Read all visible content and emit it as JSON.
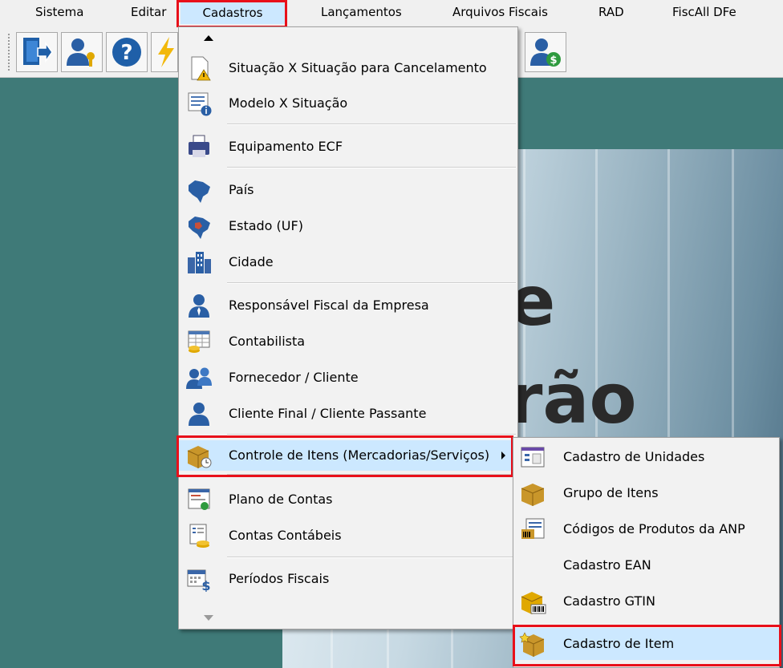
{
  "menubar": {
    "items": [
      "Sistema",
      "Editar",
      "Cadastros",
      "Lançamentos",
      "Arquivos Fiscais",
      "RAD",
      "FiscAll DFe"
    ],
    "active": "Cadastros"
  },
  "toolbar": {
    "buttons": [
      "exit-icon",
      "user-key-icon",
      "help-icon",
      "lightning-icon",
      "user-money-icon"
    ]
  },
  "banner": {
    "text_line1": "e",
    "text_line2": "rão"
  },
  "menu": {
    "items": [
      {
        "label": "Situação X Situação para Cancelamento",
        "icon": "document-warning-icon"
      },
      {
        "label": "Modelo X Situação",
        "icon": "form-info-icon"
      },
      {
        "label": "Equipamento ECF",
        "icon": "printer-icon"
      },
      {
        "label": "País",
        "icon": "brazil-map-icon"
      },
      {
        "label": "Estado (UF)",
        "icon": "brazil-state-map-icon"
      },
      {
        "label": "Cidade",
        "icon": "buildings-icon"
      },
      {
        "label": "Responsável Fiscal da Empresa",
        "icon": "person-tie-icon"
      },
      {
        "label": "Contabilista",
        "icon": "calculator-coins-icon"
      },
      {
        "label": "Fornecedor / Cliente",
        "icon": "people-icon"
      },
      {
        "label": "Cliente Final / Cliente Passante",
        "icon": "person-icon"
      },
      {
        "label": "Controle de Itens (Mercadorias/Serviços)",
        "icon": "box-clock-icon"
      },
      {
        "label": "Plano de Contas",
        "icon": "ledger-icon"
      },
      {
        "label": "Contas Contábeis",
        "icon": "accounts-coins-icon"
      },
      {
        "label": "Períodos Fiscais",
        "icon": "calendar-dollar-icon"
      }
    ],
    "highlighted": "Controle de Itens (Mercadorias/Serviços)"
  },
  "submenu": {
    "items": [
      {
        "label": "Cadastro de Unidades",
        "icon": "window-units-icon"
      },
      {
        "label": "Grupo de Itens",
        "icon": "boxes-icon"
      },
      {
        "label": "Códigos de Produtos da ANP",
        "icon": "barcode-card-icon"
      },
      {
        "label": "Cadastro EAN",
        "icon": ""
      },
      {
        "label": "Cadastro GTIN",
        "icon": "box-barcode-icon"
      },
      {
        "label": "Cadastro de Item",
        "icon": "box-new-icon"
      }
    ],
    "highlighted": "Cadastro de Item"
  },
  "colors": {
    "desktop": "#3f7a78",
    "highlight": "#cce8ff",
    "annotation_red": "#e8101a"
  }
}
